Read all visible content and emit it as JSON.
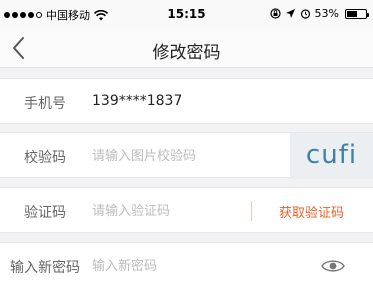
{
  "status_bar": {
    "carrier": "中国移动",
    "time": "15:15",
    "battery_percent": "53%",
    "battery_level": 0.53,
    "signal_icons": [
      "filled",
      "filled",
      "filled",
      "filled",
      "empty"
    ],
    "icons": [
      "wifi-icon",
      "screen-lock-icon",
      "location-icon",
      "alarm-icon",
      "battery-icon"
    ]
  },
  "nav": {
    "title": "修改密码",
    "back_icon": "chevron-left-icon"
  },
  "form": {
    "phone": {
      "label": "手机号",
      "value": "139****1837"
    },
    "captcha": {
      "label": "校验码",
      "placeholder": "请输入图片校验码",
      "image_text": "cufi"
    },
    "sms_code": {
      "label": "验证码",
      "placeholder": "请输入验证码",
      "button_label": "获取验证码"
    },
    "new_password": {
      "label": "输入新密码",
      "placeholder": "输入新密码",
      "toggle_icon": "eye-icon"
    }
  },
  "colors": {
    "accent": "#e8632a",
    "background": "#f2f2f4",
    "captcha_text": "#3f7fa8"
  }
}
